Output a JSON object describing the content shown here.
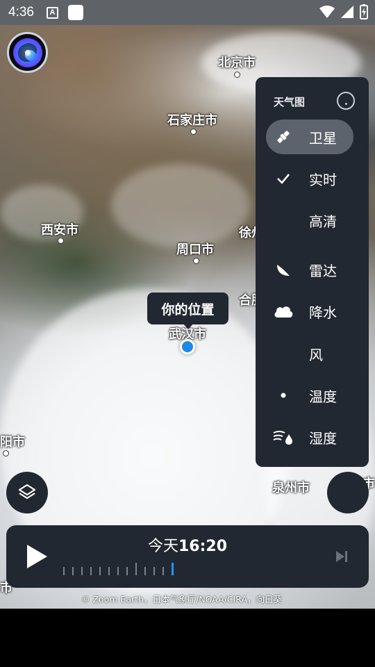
{
  "status_bar": {
    "time": "4:36",
    "a_icon_label": "A"
  },
  "map": {
    "cities": [
      {
        "name": "北京市"
      },
      {
        "name": "石家庄市"
      },
      {
        "name": "西安市"
      },
      {
        "name": "周口市"
      },
      {
        "name": "徐州"
      },
      {
        "name": "合肥"
      },
      {
        "name": "武汉市"
      },
      {
        "name": "阳市"
      },
      {
        "name": "泉州市"
      },
      {
        "name": "市"
      },
      {
        "name": "市"
      }
    ],
    "location_tooltip": "你的位置"
  },
  "layers_panel": {
    "title": "天气图",
    "items": [
      {
        "label": "卫星",
        "icon": "satellite-icon",
        "active": true
      },
      {
        "label": "实时",
        "icon": "check-icon",
        "active": false
      },
      {
        "label": "高清",
        "icon": "",
        "active": false
      },
      {
        "label": "雷达",
        "icon": "radar-icon",
        "active": false
      },
      {
        "label": "降水",
        "icon": "cloud-icon",
        "active": false
      },
      {
        "label": "风",
        "icon": "",
        "active": false
      },
      {
        "label": "温度",
        "icon": "dot-icon",
        "active": false
      },
      {
        "label": "湿度",
        "icon": "humidity-icon",
        "active": false
      }
    ]
  },
  "timeline": {
    "day": "今天",
    "time": "16:20"
  },
  "attribution": "© Zoom Earth，日本气象厅/NOAA/CIRA，向日葵",
  "colors": {
    "panel_bg": "#222831",
    "accent": "#2196f3",
    "location_dot": "#1e88e5"
  }
}
